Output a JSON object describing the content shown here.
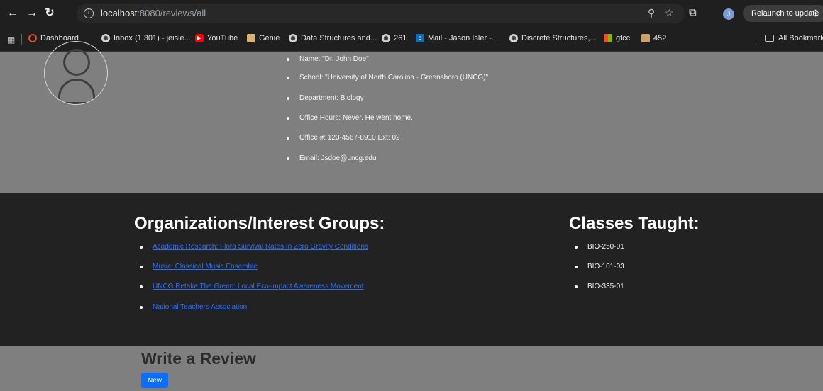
{
  "browser": {
    "url_host": "localhost",
    "url_rest": ":8080/reviews/all",
    "relaunch_label": "Relaunch to update",
    "profile_initial": "J",
    "bookmarks": [
      {
        "label": "Dashboard",
        "icon": "ring"
      },
      {
        "label": "Inbox (1,301) - jeisle...",
        "icon": "globe"
      },
      {
        "label": "YouTube",
        "icon": "youtube"
      },
      {
        "label": "Genie",
        "icon": "genie"
      },
      {
        "label": "Data Structures and...",
        "icon": "globe"
      },
      {
        "label": "261",
        "icon": "globe"
      },
      {
        "label": "Mail - Jason Isler -...",
        "icon": "outlook"
      },
      {
        "label": "Discrete Structures,...",
        "icon": "globe"
      },
      {
        "label": "gtcc",
        "icon": "microsoft"
      },
      {
        "label": "452",
        "icon": "record"
      }
    ],
    "all_bookmarks_label": "All Bookmarks"
  },
  "profile": {
    "name": "Name: \"Dr. John Doe\"",
    "school": "School: \"University of North Carolina - Greensboro (UNCG)\"",
    "department": "Department: Biology",
    "office_hours": "Office Hours: Never. He went home.",
    "office_number": "Office #: 123-4567-8910 Ext: 02",
    "email": "Email: Jsdoe@uncg.edu"
  },
  "organizations": {
    "title": "Organizations/Interest Groups:",
    "items": [
      "Academic Research: Flora Survival Rates In Zero Gravity Conditions",
      "Music: Classical Music Ensemble",
      "UNCG Retake The Green: Local Eco-impact Awareness Movement",
      "National Teachers Association"
    ]
  },
  "classes": {
    "title": "Classes Taught:",
    "items": [
      "BIO-250-01",
      "BIO-101-03",
      "BIO-335-01"
    ]
  },
  "review": {
    "title": "Write a Review",
    "new_label": "New"
  },
  "colors": {
    "page_bg": "#7f7f7f",
    "dark_bg": "#222222",
    "link": "#2f6ff5",
    "button": "#0d6efd"
  }
}
